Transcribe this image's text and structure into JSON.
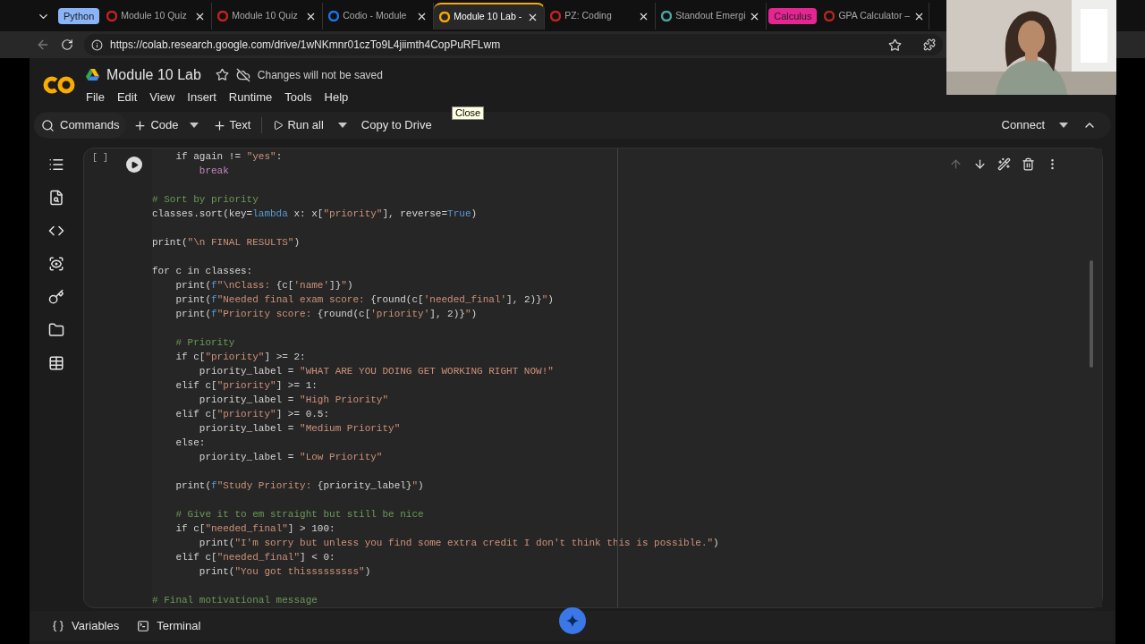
{
  "browser": {
    "tabs": [
      {
        "kind": "group",
        "title": "Python",
        "color": "#8ab4f8"
      },
      {
        "kind": "tab",
        "title": "Module 10 Quiz",
        "color": "#c5221f",
        "selected": false
      },
      {
        "kind": "tab",
        "title": "Module 10 Quiz",
        "color": "#c5221f",
        "selected": false
      },
      {
        "kind": "tab",
        "title": "Codio - Module",
        "color": "#1a73e8",
        "selected": false
      },
      {
        "kind": "tab",
        "title": "Module 10 Lab -",
        "color": "#f9ab00",
        "selected": true
      },
      {
        "kind": "tab",
        "title": "PZ: Coding",
        "color": "#c5221f",
        "selected": false
      },
      {
        "kind": "tab",
        "title": "Standout Emergi",
        "color": "#4fa3a5",
        "selected": false
      },
      {
        "kind": "group",
        "title": "Calculus",
        "color": "#e52592"
      },
      {
        "kind": "tab",
        "title": "GPA Calculator –",
        "color": "#b3261e",
        "selected": false
      }
    ],
    "url": "https://colab.research.google.com/drive/1wNKmnr01czTo9L4jiimth4CopPuRFLwm"
  },
  "notebook": {
    "title": "Module 10 Lab",
    "save_status": "Changes will not be saved",
    "menu": [
      "File",
      "Edit",
      "View",
      "Insert",
      "Runtime",
      "Tools",
      "Help"
    ]
  },
  "toolbar": {
    "commands": "Commands",
    "add_code": "Code",
    "add_text": "Text",
    "run_all": "Run all",
    "copy": "Copy to Drive",
    "connect": "Connect",
    "tooltip": "Close"
  },
  "cell": {
    "execution_count": "[ ]",
    "actions": [
      {
        "kind": "up",
        "disabled": true
      },
      {
        "kind": "down",
        "disabled": false
      },
      {
        "kind": "edit",
        "disabled": false
      },
      {
        "kind": "delete",
        "disabled": false
      },
      {
        "kind": "more",
        "disabled": false
      }
    ],
    "lines": [
      {
        "kind": "code",
        "segments": [
          {
            "kind": "plain",
            "text": "    if again != "
          },
          {
            "kind": "string",
            "text": "\"yes\""
          },
          {
            "kind": "plain",
            "text": ":"
          }
        ]
      },
      {
        "kind": "code",
        "segments": [
          {
            "kind": "flow",
            "text": "        break"
          }
        ]
      },
      {
        "kind": "blank"
      },
      {
        "kind": "code",
        "segments": [
          {
            "kind": "comment",
            "text": "# Sort by priority"
          }
        ]
      },
      {
        "kind": "code",
        "segments": [
          {
            "kind": "plain",
            "text": "classes.sort(key="
          },
          {
            "kind": "keyword",
            "text": "lambda"
          },
          {
            "kind": "plain",
            "text": " x: x["
          },
          {
            "kind": "string",
            "text": "\"priority\""
          },
          {
            "kind": "plain",
            "text": "], reverse="
          },
          {
            "kind": "keyword",
            "text": "True"
          },
          {
            "kind": "plain",
            "text": ")"
          }
        ]
      },
      {
        "kind": "blank"
      },
      {
        "kind": "code",
        "segments": [
          {
            "kind": "plain",
            "text": "print("
          },
          {
            "kind": "string",
            "text": "\"\\n FINAL RESULTS\""
          },
          {
            "kind": "plain",
            "text": ")"
          }
        ]
      },
      {
        "kind": "blank"
      },
      {
        "kind": "code",
        "segments": [
          {
            "kind": "plain",
            "text": "for c in classes:"
          }
        ]
      },
      {
        "kind": "code",
        "segments": [
          {
            "kind": "plain",
            "text": "    print("
          },
          {
            "kind": "keyword",
            "text": "f"
          },
          {
            "kind": "string",
            "text": "\"\\nClass: "
          },
          {
            "kind": "plain",
            "text": "{c["
          },
          {
            "kind": "string",
            "text": "'name'"
          },
          {
            "kind": "plain",
            "text": "]}"
          },
          {
            "kind": "string",
            "text": "\""
          },
          {
            "kind": "plain",
            "text": ")"
          }
        ]
      },
      {
        "kind": "code",
        "segments": [
          {
            "kind": "plain",
            "text": "    print("
          },
          {
            "kind": "keyword",
            "text": "f"
          },
          {
            "kind": "string",
            "text": "\"Needed final exam score: "
          },
          {
            "kind": "plain",
            "text": "{round(c["
          },
          {
            "kind": "string",
            "text": "'needed_final'"
          },
          {
            "kind": "plain",
            "text": "], 2)}"
          },
          {
            "kind": "string",
            "text": "\""
          },
          {
            "kind": "plain",
            "text": ")"
          }
        ]
      },
      {
        "kind": "code",
        "segments": [
          {
            "kind": "plain",
            "text": "    print("
          },
          {
            "kind": "keyword",
            "text": "f"
          },
          {
            "kind": "string",
            "text": "\"Priority score: "
          },
          {
            "kind": "plain",
            "text": "{round(c["
          },
          {
            "kind": "string",
            "text": "'priority'"
          },
          {
            "kind": "plain",
            "text": "], 2)}"
          },
          {
            "kind": "string",
            "text": "\""
          },
          {
            "kind": "plain",
            "text": ")"
          }
        ]
      },
      {
        "kind": "blank"
      },
      {
        "kind": "code",
        "segments": [
          {
            "kind": "comment",
            "text": "    # Priority"
          }
        ]
      },
      {
        "kind": "code",
        "segments": [
          {
            "kind": "plain",
            "text": "    if c["
          },
          {
            "kind": "string",
            "text": "\"priority\""
          },
          {
            "kind": "plain",
            "text": "] >= 2:"
          }
        ]
      },
      {
        "kind": "code",
        "segments": [
          {
            "kind": "plain",
            "text": "        priority_label = "
          },
          {
            "kind": "string",
            "text": "\"WHAT ARE YOU DOING GET WORKING RIGHT NOW!\""
          }
        ]
      },
      {
        "kind": "code",
        "segments": [
          {
            "kind": "plain",
            "text": "    elif c["
          },
          {
            "kind": "string",
            "text": "\"priority\""
          },
          {
            "kind": "plain",
            "text": "] >= 1:"
          }
        ]
      },
      {
        "kind": "code",
        "segments": [
          {
            "kind": "plain",
            "text": "        priority_label = "
          },
          {
            "kind": "string",
            "text": "\"High Priority\""
          }
        ]
      },
      {
        "kind": "code",
        "segments": [
          {
            "kind": "plain",
            "text": "    elif c["
          },
          {
            "kind": "string",
            "text": "\"priority\""
          },
          {
            "kind": "plain",
            "text": "] >= 0.5:"
          }
        ]
      },
      {
        "kind": "code",
        "segments": [
          {
            "kind": "plain",
            "text": "        priority_label = "
          },
          {
            "kind": "string",
            "text": "\"Medium Priority\""
          }
        ]
      },
      {
        "kind": "code",
        "segments": [
          {
            "kind": "plain",
            "text": "    else:"
          }
        ]
      },
      {
        "kind": "code",
        "segments": [
          {
            "kind": "plain",
            "text": "        priority_label = "
          },
          {
            "kind": "string",
            "text": "\"Low Priority\""
          }
        ]
      },
      {
        "kind": "blank"
      },
      {
        "kind": "code",
        "segments": [
          {
            "kind": "plain",
            "text": "    print("
          },
          {
            "kind": "keyword",
            "text": "f"
          },
          {
            "kind": "string",
            "text": "\"Study Priority: "
          },
          {
            "kind": "plain",
            "text": "{priority_label}"
          },
          {
            "kind": "string",
            "text": "\""
          },
          {
            "kind": "plain",
            "text": ")"
          }
        ]
      },
      {
        "kind": "blank"
      },
      {
        "kind": "code",
        "segments": [
          {
            "kind": "comment",
            "text": "    # Give it to em straight but still be nice"
          }
        ]
      },
      {
        "kind": "code",
        "segments": [
          {
            "kind": "plain",
            "text": "    if c["
          },
          {
            "kind": "string",
            "text": "\"needed_final\""
          },
          {
            "kind": "plain",
            "text": "] > 100:"
          }
        ]
      },
      {
        "kind": "code",
        "segments": [
          {
            "kind": "plain",
            "text": "        print("
          },
          {
            "kind": "string",
            "text": "\"I'm sorry but unless you find some extra credit I don't think this is possible.\""
          },
          {
            "kind": "plain",
            "text": ")"
          }
        ]
      },
      {
        "kind": "code",
        "segments": [
          {
            "kind": "plain",
            "text": "    elif c["
          },
          {
            "kind": "string",
            "text": "\"needed_final\""
          },
          {
            "kind": "plain",
            "text": "] < 0:"
          }
        ]
      },
      {
        "kind": "code",
        "segments": [
          {
            "kind": "plain",
            "text": "        print("
          },
          {
            "kind": "string",
            "text": "\"You got thisssssssss\""
          },
          {
            "kind": "plain",
            "text": ")"
          }
        ]
      },
      {
        "kind": "blank"
      },
      {
        "kind": "code",
        "segments": [
          {
            "kind": "comment",
            "text": "# Final motivational message"
          }
        ]
      }
    ]
  },
  "bottom_bar": {
    "variables": "Variables",
    "terminal": "Terminal"
  }
}
